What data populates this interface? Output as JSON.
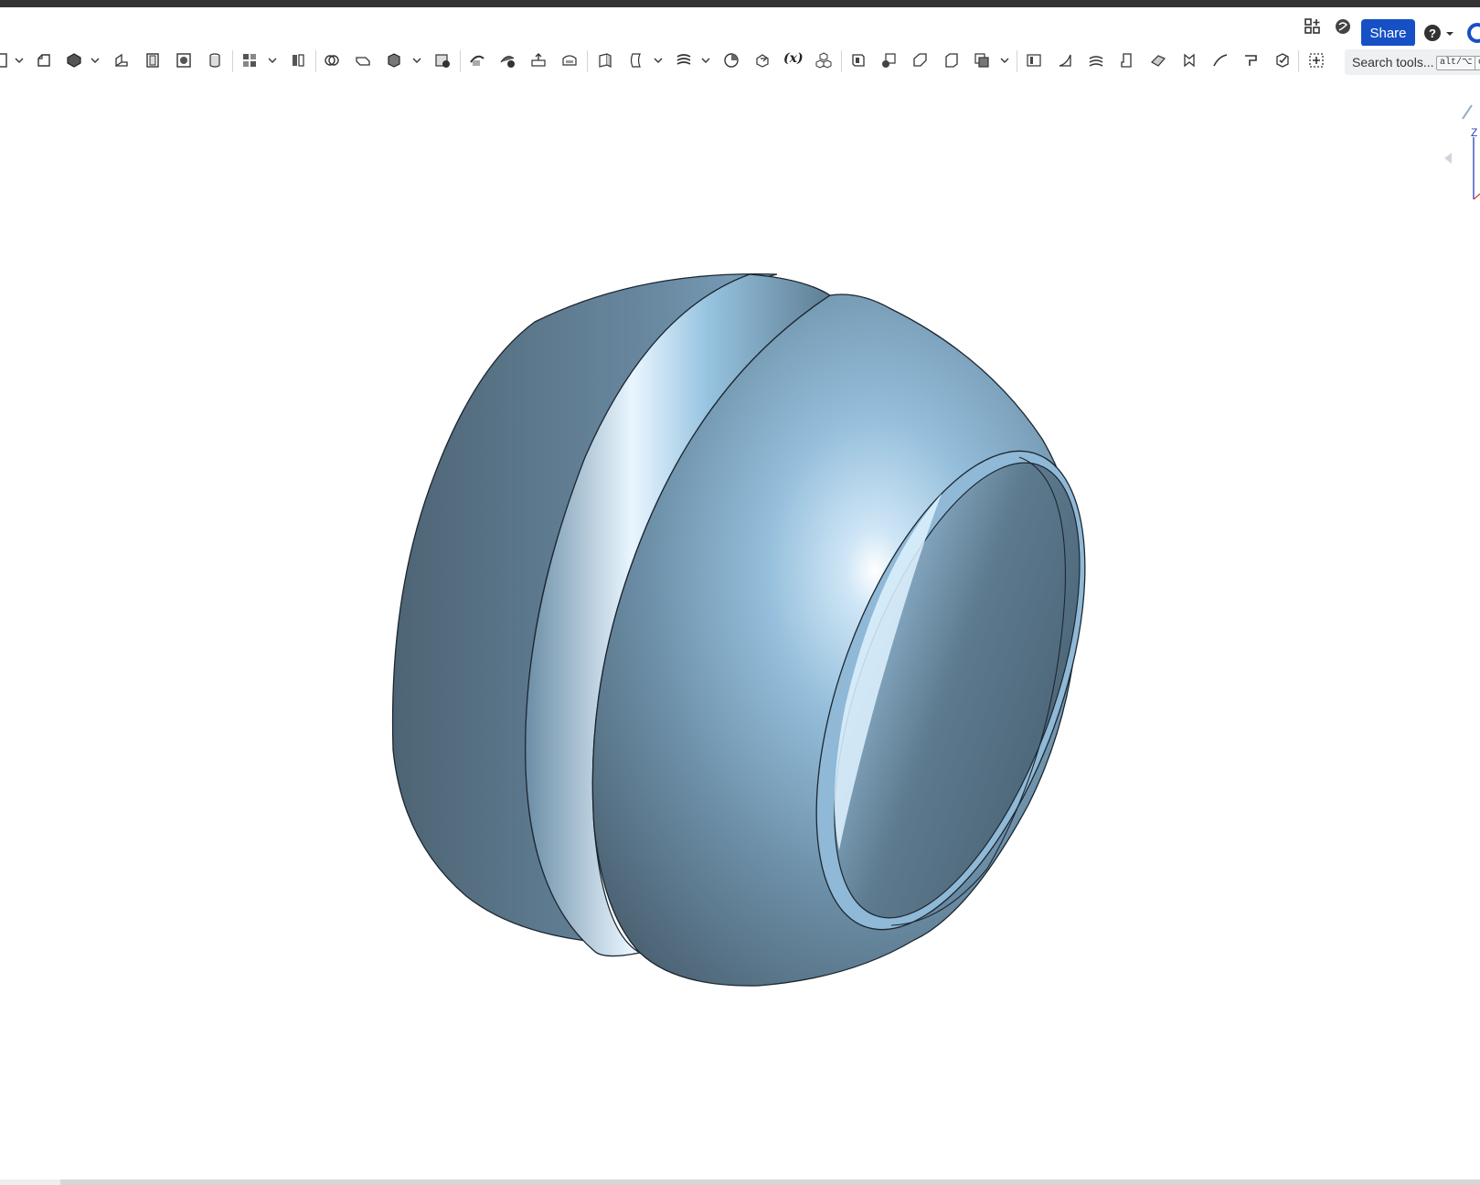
{
  "header": {
    "share_label": "Share",
    "icons": [
      "app-store-icon",
      "learning-center-icon",
      "help-icon",
      "chevron-down-icon"
    ]
  },
  "toolbar": {
    "icons": [
      "sketch-icon",
      "extrude-icon",
      "revolve-icon",
      "sweep-icon",
      "loft-icon",
      "thicken-icon",
      "shell-icon",
      "hole-icon",
      "boolean-icon",
      "split-icon",
      "transform-icon",
      "delete-part-icon",
      "fillet-icon",
      "chamfer-icon",
      "draft-icon",
      "rib-icon",
      "plane-icon",
      "helix-icon",
      "mate-connector-icon",
      "variable-icon",
      "pattern-icon",
      "sheet-metal-icon",
      "frame-icon"
    ],
    "variable_label": "(x)",
    "search_placeholder": "Search tools...",
    "search_shortcut_1": "alt/⌥",
    "search_shortcut_2": "c"
  },
  "view_cube": {
    "axis_label": "Z"
  },
  "colors": {
    "accent": "#1650c4",
    "part_light": "#9ccbea",
    "part_dark": "#4a6070",
    "edge": "#1c2630"
  }
}
